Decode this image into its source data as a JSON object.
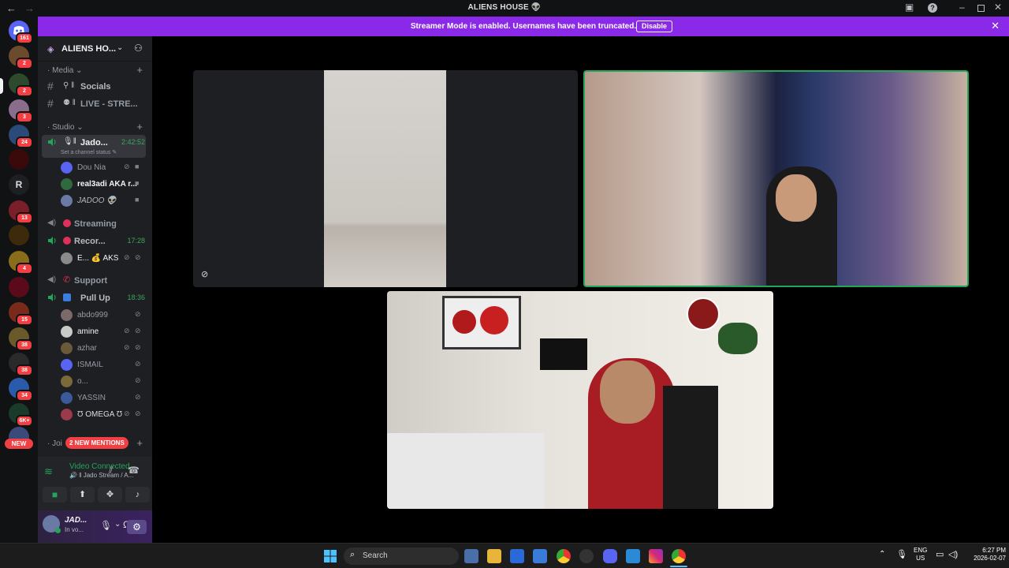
{
  "window": {
    "title": "ALIENS HOUSE 👽",
    "back": "←",
    "forward": "→"
  },
  "banner": {
    "message": "Streamer Mode is enabled. Usernames have been truncated.",
    "button": "Disable",
    "close": "✕"
  },
  "rail": {
    "badges": [
      "161",
      "2",
      "2",
      "3",
      "24",
      "13",
      "4",
      "15",
      "38",
      "38",
      "34",
      "6K+",
      "NEW"
    ],
    "letter": "R"
  },
  "guild": {
    "name": "ALIENS HO..."
  },
  "categories": {
    "media": "Media",
    "studio": "Studio",
    "join": "Joi"
  },
  "channels": {
    "socials": "Socials",
    "live": "LIVE - STRE...",
    "jado": "Jado...",
    "jado_time": "2:42:52",
    "jado_status": "Set a channel status",
    "streaming": "Streaming",
    "recording": "Recor...",
    "recording_time": "17:28",
    "support": "Support",
    "pullup": "Pull Up",
    "pullup_time": "18:36"
  },
  "members": {
    "jado": [
      "Dou Nia",
      "real3adi AKA r...",
      "JADOO 👽"
    ],
    "recording": [
      "E... 💰 AKS"
    ],
    "pullup": [
      "abdo999",
      "amine",
      "azhar",
      "ISMAIL",
      "o...",
      "YASSIN",
      "Ʊ OMEGA Ʊ"
    ]
  },
  "mentions": "2 NEW MENTIONS",
  "voice": {
    "status": "Video Connected",
    "channel": "Jado Stream / A..."
  },
  "user": {
    "name": "JAD...",
    "substatus": "In vo..."
  },
  "taskbar": {
    "search": "Search",
    "lang1": "ENG",
    "lang2": "US",
    "time": "6:27 PM",
    "date": "2026-02-07"
  },
  "colors": {
    "accent": "#8a2ae8",
    "online": "#23a55a",
    "danger": "#f23f43",
    "blurple": "#5865f2"
  }
}
